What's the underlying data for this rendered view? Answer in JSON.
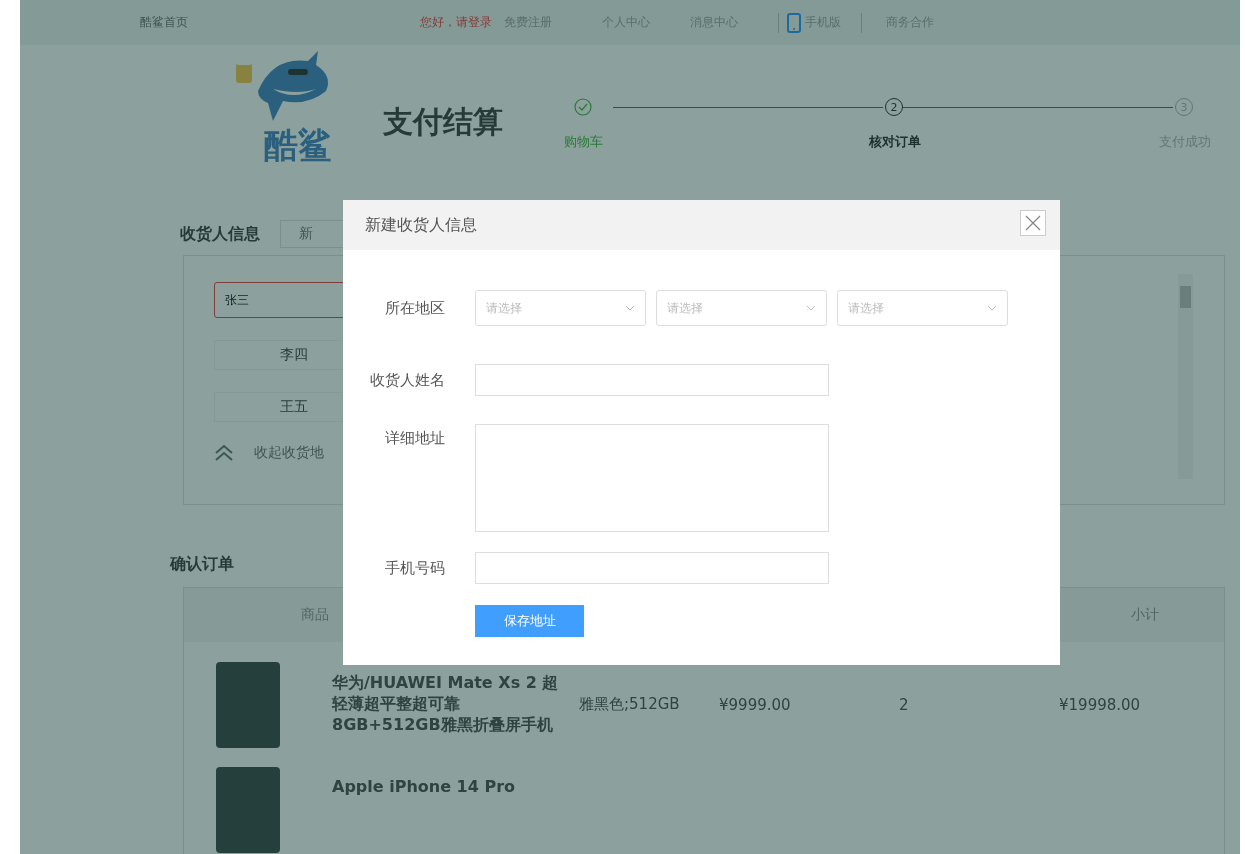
{
  "top_bar": {
    "home": "酷鲨首页",
    "greeting": "您好，请登录",
    "register": "免费注册",
    "links": [
      {
        "label": "个人中心",
        "kind": "text"
      },
      {
        "label": "消息中心",
        "kind": "text"
      },
      {
        "label": "手机版",
        "kind": "phone"
      },
      {
        "label": "商务合作",
        "kind": "text"
      }
    ]
  },
  "logo": {
    "text": "酷鲨"
  },
  "page_title": "支付结算",
  "steps": [
    {
      "label": "购物车",
      "done": true,
      "current": false
    },
    {
      "label": "核对订单",
      "done": false,
      "current": true,
      "number": "2"
    },
    {
      "label": "支付成功",
      "done": false,
      "current": false,
      "number": "3"
    }
  ],
  "consignee": {
    "title": "收货人信息",
    "add_button": "新",
    "items": [
      {
        "name": "张三",
        "selected": true
      },
      {
        "name": "李四",
        "selected": false
      },
      {
        "name": "王五",
        "selected": false
      }
    ],
    "collapse_link": "收起收货地"
  },
  "order": {
    "title": "确认订单",
    "columns": [
      "商品",
      "小计"
    ],
    "rows": [
      {
        "name": "华为/HUAWEI Mate Xs 2 超轻薄超平整超可靠8GB+512GB雅黑折叠屏手机",
        "spec": "雅黑色;512GB",
        "price": "¥9999.00",
        "quantity": "2",
        "subtotal": "¥19998.00"
      },
      {
        "name": "Apple iPhone 14 Pro"
      }
    ]
  },
  "modal": {
    "title": "新建收货人信息",
    "region_label": "所在地区",
    "region_selects": [
      {
        "placeholder": "请选择"
      },
      {
        "placeholder": "请选择"
      },
      {
        "placeholder": "请选择"
      }
    ],
    "name_label": "收货人姓名",
    "address_label": "详细地址",
    "phone_label": "手机号码",
    "save_button": "保存地址"
  }
}
